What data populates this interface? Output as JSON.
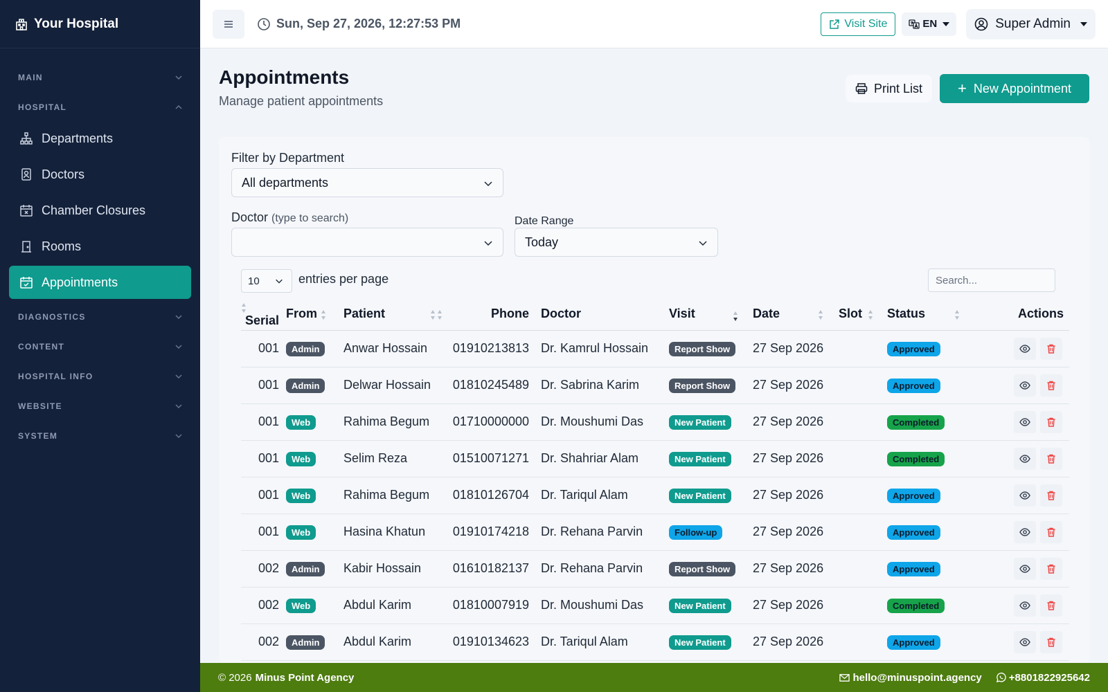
{
  "sidebar": {
    "brand": "Your Hospital",
    "sections": {
      "main": "MAIN",
      "hospital": "HOSPITAL",
      "diagnostics": "DIAGNOSTICS",
      "content": "CONTENT",
      "hospital_info": "HOSPITAL INFO",
      "website": "WEBSITE",
      "system": "SYSTEM"
    },
    "items": [
      {
        "label": "Departments",
        "icon": "sitemap-icon"
      },
      {
        "label": "Doctors",
        "icon": "id-badge-icon"
      },
      {
        "label": "Chamber Closures",
        "icon": "calendar-x-icon"
      },
      {
        "label": "Rooms",
        "icon": "door-icon"
      },
      {
        "label": "Appointments",
        "icon": "calendar-check-icon",
        "active": true
      }
    ]
  },
  "topbar": {
    "datetime": "Sun, Sep 27, 2026, 12:27:53 PM",
    "visit_site": "Visit Site",
    "language": "EN",
    "user": "Super Admin"
  },
  "page": {
    "title": "Appointments",
    "subtitle": "Manage patient appointments",
    "print_label": "Print List",
    "new_label": "New Appointment"
  },
  "filters": {
    "department_label": "Filter by Department",
    "department_value": "All departments",
    "doctor_label": "Doctor",
    "doctor_hint": "(type to search)",
    "doctor_value": "",
    "date_label": "Date Range",
    "date_value": "Today"
  },
  "table": {
    "entries_value": "10",
    "entries_label": "entries per page",
    "search_placeholder": "Search...",
    "columns": [
      "Serial",
      "From",
      "Patient",
      "Phone",
      "Doctor",
      "Visit",
      "Date",
      "Slot",
      "Status",
      "Actions"
    ],
    "rows": [
      {
        "serial": "001",
        "from": "Admin",
        "patient": "Anwar Hossain",
        "phone": "01910213813",
        "doctor": "Dr. Kamrul Hossain",
        "visit": "Report Show",
        "date": "27 Sep 2026",
        "slot": "",
        "status": "Approved"
      },
      {
        "serial": "001",
        "from": "Admin",
        "patient": "Delwar Hossain",
        "phone": "01810245489",
        "doctor": "Dr. Sabrina Karim",
        "visit": "Report Show",
        "date": "27 Sep 2026",
        "slot": "",
        "status": "Approved"
      },
      {
        "serial": "001",
        "from": "Web",
        "patient": "Rahima Begum",
        "phone": "01710000000",
        "doctor": "Dr. Moushumi Das",
        "visit": "New Patient",
        "date": "27 Sep 2026",
        "slot": "",
        "status": "Completed"
      },
      {
        "serial": "001",
        "from": "Web",
        "patient": "Selim Reza",
        "phone": "01510071271",
        "doctor": "Dr. Shahriar Alam",
        "visit": "New Patient",
        "date": "27 Sep 2026",
        "slot": "",
        "status": "Completed"
      },
      {
        "serial": "001",
        "from": "Web",
        "patient": "Rahima Begum",
        "phone": "01810126704",
        "doctor": "Dr. Tariqul Alam",
        "visit": "New Patient",
        "date": "27 Sep 2026",
        "slot": "",
        "status": "Approved"
      },
      {
        "serial": "001",
        "from": "Web",
        "patient": "Hasina Khatun",
        "phone": "01910174218",
        "doctor": "Dr. Rehana Parvin",
        "visit": "Follow-up",
        "date": "27 Sep 2026",
        "slot": "",
        "status": "Approved"
      },
      {
        "serial": "002",
        "from": "Admin",
        "patient": "Kabir Hossain",
        "phone": "01610182137",
        "doctor": "Dr. Rehana Parvin",
        "visit": "Report Show",
        "date": "27 Sep 2026",
        "slot": "",
        "status": "Approved"
      },
      {
        "serial": "002",
        "from": "Web",
        "patient": "Abdul Karim",
        "phone": "01810007919",
        "doctor": "Dr. Moushumi Das",
        "visit": "New Patient",
        "date": "27 Sep 2026",
        "slot": "",
        "status": "Completed"
      },
      {
        "serial": "002",
        "from": "Admin",
        "patient": "Abdul Karim",
        "phone": "01910134623",
        "doctor": "Dr. Tariqul Alam",
        "visit": "New Patient",
        "date": "27 Sep 2026",
        "slot": "",
        "status": "Approved"
      }
    ]
  },
  "footer": {
    "copyright": "© 2026",
    "company": "Minus Point Agency",
    "email": "hello@minuspoint.agency",
    "phone": "+8801822925642"
  },
  "colors": {
    "sidebar_bg": "#14213a",
    "accent": "#0f9b8e",
    "footer_bg": "#4d7c0f",
    "approved": "#0ea5e9",
    "completed": "#16a34a",
    "neutral_badge": "#4b5563"
  }
}
